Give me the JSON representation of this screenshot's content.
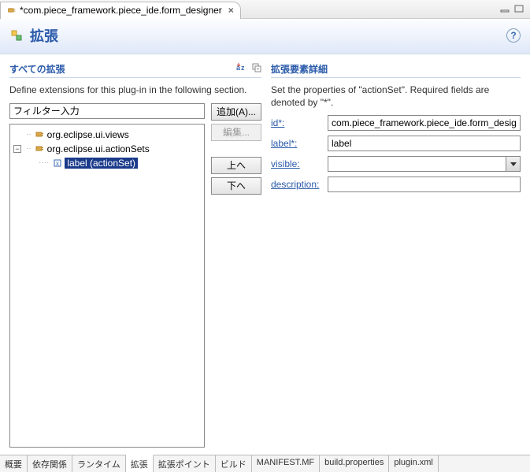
{
  "editorTab": {
    "title": "*com.piece_framework.piece_ide.form_designer"
  },
  "header": {
    "title": "拡張"
  },
  "left": {
    "sectionTitle": "すべての拡張",
    "description": "Define extensions for this plug-in in the following section.",
    "filterPlaceholder": "フィルター入力",
    "tree": {
      "n0": {
        "label": "org.eclipse.ui.views"
      },
      "n1": {
        "label": "org.eclipse.ui.actionSets"
      },
      "n2": {
        "label": "label (actionSet)"
      }
    },
    "buttons": {
      "add": "追加(A)...",
      "edit": "編集...",
      "up": "上へ",
      "down": "下へ"
    }
  },
  "right": {
    "sectionTitle": "拡張要素詳細",
    "description": "Set the properties of \"actionSet\". Required fields are denoted by \"*\".",
    "props": {
      "idLabel": "id*:",
      "idValue": "com.piece_framework.piece_ide.form_designer",
      "labelLabel": "label*:",
      "labelValue": "label",
      "visibleLabel": "visible:",
      "visibleValue": "",
      "descriptionLabel": "description:",
      "descriptionValue": ""
    }
  },
  "bottomTabs": {
    "t0": "概要",
    "t1": "依存関係",
    "t2": "ランタイム",
    "t3": "拡張",
    "t4": "拡張ポイント",
    "t5": "ビルド",
    "t6": "MANIFEST.MF",
    "t7": "build.properties",
    "t8": "plugin.xml"
  }
}
